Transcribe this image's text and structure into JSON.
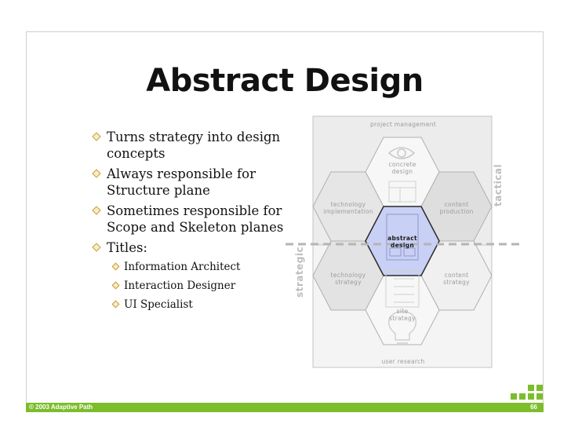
{
  "title": "Abstract Design",
  "bullets": [
    "Turns strategy into design concepts",
    "Always responsible for Structure plane",
    "Sometimes responsible for Scope and Skeleton planes",
    "Titles:"
  ],
  "titles": [
    "Information Architect",
    "Interaction Designer",
    "UI Specialist"
  ],
  "diagram": {
    "project_management": "project management",
    "concrete_design": "concrete design",
    "technology_implementation": "technology implementation",
    "content_production": "content production",
    "abstract_design": "abstract design",
    "technology_strategy": "technology strategy",
    "content_strategy": "content strategy",
    "site_strategy": "site strategy",
    "user_research": "user research",
    "tactical": "tactical",
    "strategic": "strategic",
    "highlight_color": "#c8d0f5"
  },
  "footer": {
    "copyright": "© 2003 Adaptive Path",
    "page_number": "66"
  },
  "colors": {
    "accent": "#7dbd2c",
    "bullet": "#c99a2a"
  }
}
